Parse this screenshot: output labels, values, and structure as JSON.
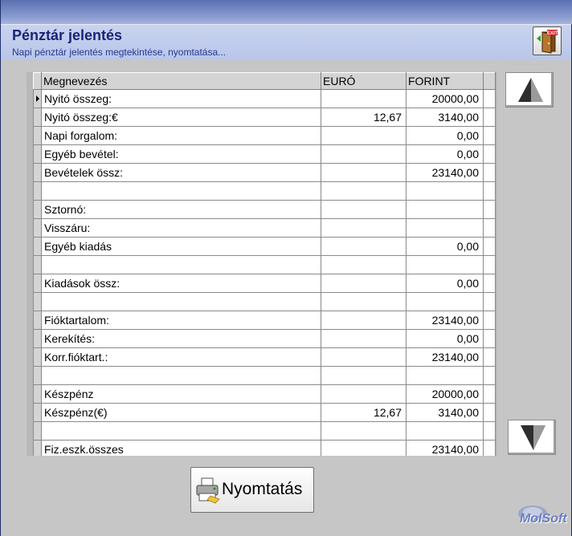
{
  "header": {
    "title": "Pénztár jelentés",
    "subtitle": "Napi pénztár jelentés megtekintése, nyomtatása...",
    "exit_icon_text": "EXIT"
  },
  "grid": {
    "columns": [
      "Megnevezés",
      "EURÓ",
      "FORINT"
    ],
    "rows": [
      {
        "name": "Nyitó összeg:",
        "euro": "",
        "forint": "20000,00"
      },
      {
        "name": "Nyitó összeg:€",
        "euro": "12,67",
        "forint": "3140,00"
      },
      {
        "name": "Napi forgalom:",
        "euro": "",
        "forint": "0,00"
      },
      {
        "name": "Egyéb bevétel:",
        "euro": "",
        "forint": "0,00"
      },
      {
        "name": "Bevételek össz:",
        "euro": "",
        "forint": "23140,00"
      },
      {
        "name": "",
        "euro": "",
        "forint": ""
      },
      {
        "name": "Sztornó:",
        "euro": "",
        "forint": ""
      },
      {
        "name": "Visszáru:",
        "euro": "",
        "forint": ""
      },
      {
        "name": "Egyéb kiadás",
        "euro": "",
        "forint": "0,00"
      },
      {
        "name": "",
        "euro": "",
        "forint": ""
      },
      {
        "name": "Kiadások össz:",
        "euro": "",
        "forint": "0,00"
      },
      {
        "name": "",
        "euro": "",
        "forint": ""
      },
      {
        "name": "Fióktartalom:",
        "euro": "",
        "forint": "23140,00"
      },
      {
        "name": "Kerekítés:",
        "euro": "",
        "forint": "0,00"
      },
      {
        "name": "Korr.fióktart.:",
        "euro": "",
        "forint": "23140,00"
      },
      {
        "name": "",
        "euro": "",
        "forint": ""
      },
      {
        "name": "Készpénz",
        "euro": "",
        "forint": "20000,00"
      },
      {
        "name": "Készpénz(€)",
        "euro": "12,67",
        "forint": "3140,00"
      },
      {
        "name": "",
        "euro": "",
        "forint": ""
      },
      {
        "name": "Fiz.eszk.összes",
        "euro": "",
        "forint": "23140,00"
      }
    ]
  },
  "buttons": {
    "print_label": "Nyomtatás",
    "scroll_up_icon": "triangle-up-icon",
    "scroll_down_icon": "triangle-down-icon"
  },
  "logo": {
    "text": "MolSoft"
  },
  "colors": {
    "title": "#1a2478",
    "header_bg": "#c3cfee",
    "window_bg": "#c6c6c6"
  }
}
